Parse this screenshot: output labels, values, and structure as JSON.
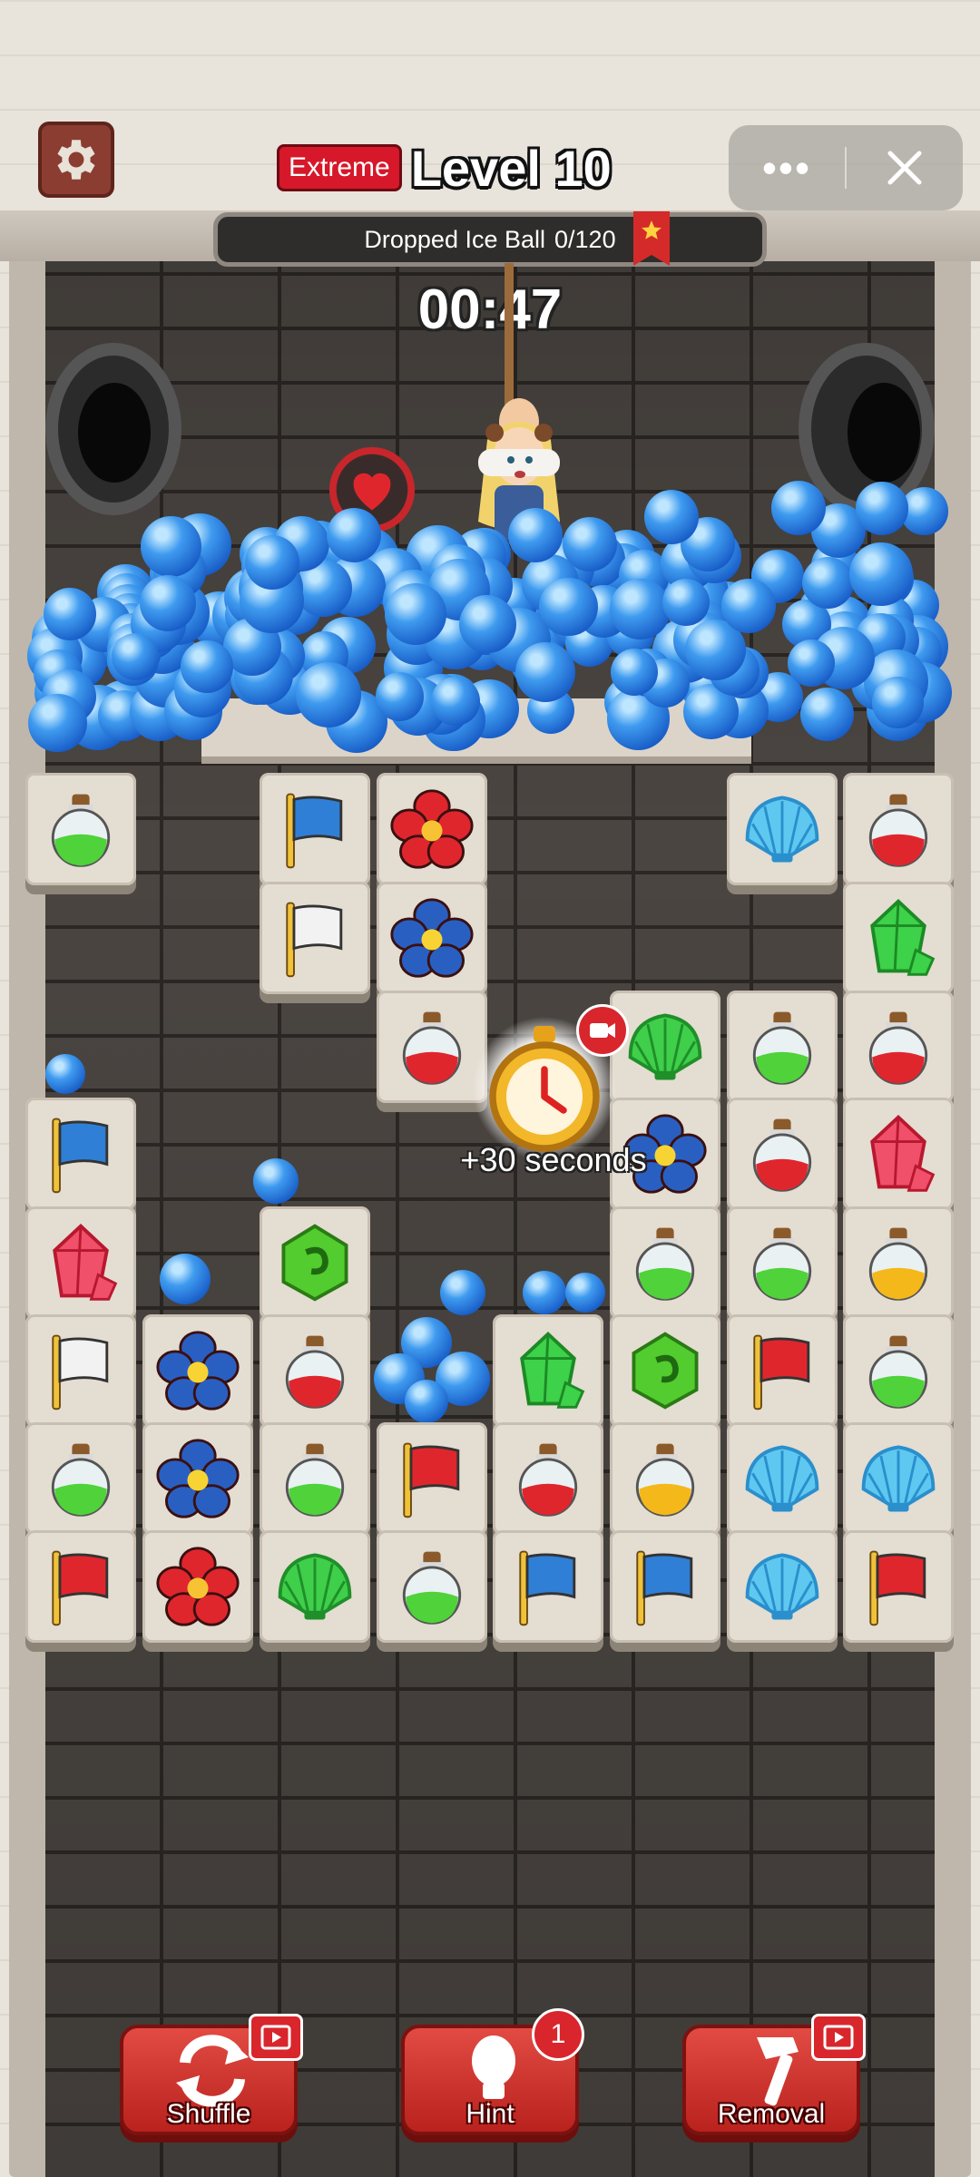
{
  "header": {
    "difficulty_badge": "Extreme",
    "level_title": "Level 10",
    "settings_icon": "gear-icon",
    "more_icon": "more-dots-icon",
    "close_icon": "close-icon"
  },
  "goal": {
    "label": "Dropped Ice Ball",
    "progress": "0/120",
    "icon": "star-ribbon-icon"
  },
  "timer": "00:47",
  "bonus": {
    "text": "+30 seconds",
    "icon": "stopwatch-icon",
    "video_icon": "video-camera-icon"
  },
  "board": {
    "tiles": [
      {
        "id": "r0c0",
        "icon": "green-potion"
      },
      {
        "id": "r0c2",
        "icon": "blue-flag"
      },
      {
        "id": "r0c3",
        "icon": "red-flower"
      },
      {
        "id": "r0c6",
        "icon": "blue-shell"
      },
      {
        "id": "r0c7",
        "icon": "red-potion"
      },
      {
        "id": "r1c2",
        "icon": "white-flag"
      },
      {
        "id": "r1c3",
        "icon": "blue-flower"
      },
      {
        "id": "r1c7",
        "icon": "green-gem"
      },
      {
        "id": "r2c3",
        "icon": "red-potion"
      },
      {
        "id": "r2c5",
        "icon": "green-shell"
      },
      {
        "id": "r2c6",
        "icon": "green-potion"
      },
      {
        "id": "r2c7",
        "icon": "red-potion"
      },
      {
        "id": "r3c0",
        "icon": "blue-flag"
      },
      {
        "id": "r3c5",
        "icon": "blue-flower"
      },
      {
        "id": "r3c6",
        "icon": "red-potion"
      },
      {
        "id": "r3c7",
        "icon": "red-gem"
      },
      {
        "id": "r4c0",
        "icon": "red-gem"
      },
      {
        "id": "r4c2",
        "icon": "green-rune"
      },
      {
        "id": "r4c5",
        "icon": "green-potion"
      },
      {
        "id": "r4c6",
        "icon": "green-potion"
      },
      {
        "id": "r4c7",
        "icon": "yellow-potion"
      },
      {
        "id": "r5c0",
        "icon": "white-flag"
      },
      {
        "id": "r5c1",
        "icon": "blue-flower"
      },
      {
        "id": "r5c2",
        "icon": "red-potion"
      },
      {
        "id": "r5c4",
        "icon": "green-gem"
      },
      {
        "id": "r5c5",
        "icon": "green-rune"
      },
      {
        "id": "r5c6",
        "icon": "red-flag"
      },
      {
        "id": "r5c7",
        "icon": "green-potion"
      },
      {
        "id": "r6c0",
        "icon": "green-potion"
      },
      {
        "id": "r6c1",
        "icon": "blue-flower"
      },
      {
        "id": "r6c2",
        "icon": "green-potion"
      },
      {
        "id": "r6c3",
        "icon": "red-flag"
      },
      {
        "id": "r6c4",
        "icon": "red-potion"
      },
      {
        "id": "r6c5",
        "icon": "yellow-potion"
      },
      {
        "id": "r6c6",
        "icon": "blue-shell"
      },
      {
        "id": "r6c7",
        "icon": "blue-shell"
      },
      {
        "id": "r7c0",
        "icon": "red-flag"
      },
      {
        "id": "r7c1",
        "icon": "red-flower"
      },
      {
        "id": "r7c2",
        "icon": "green-shell"
      },
      {
        "id": "r7c3",
        "icon": "green-potion"
      },
      {
        "id": "r7c4",
        "icon": "blue-flag"
      },
      {
        "id": "r7c5",
        "icon": "blue-flag"
      },
      {
        "id": "r7c6",
        "icon": "blue-shell"
      },
      {
        "id": "r7c7",
        "icon": "red-flag"
      }
    ]
  },
  "powerups": {
    "shuffle": {
      "label": "Shuffle",
      "icon": "shuffle-arrows-icon",
      "badge_icon": "video-film-icon"
    },
    "hint": {
      "label": "Hint",
      "icon": "lightbulb-icon",
      "badge_count": "1"
    },
    "removal": {
      "label": "Removal",
      "icon": "hammer-icon",
      "badge_icon": "video-film-icon"
    }
  }
}
